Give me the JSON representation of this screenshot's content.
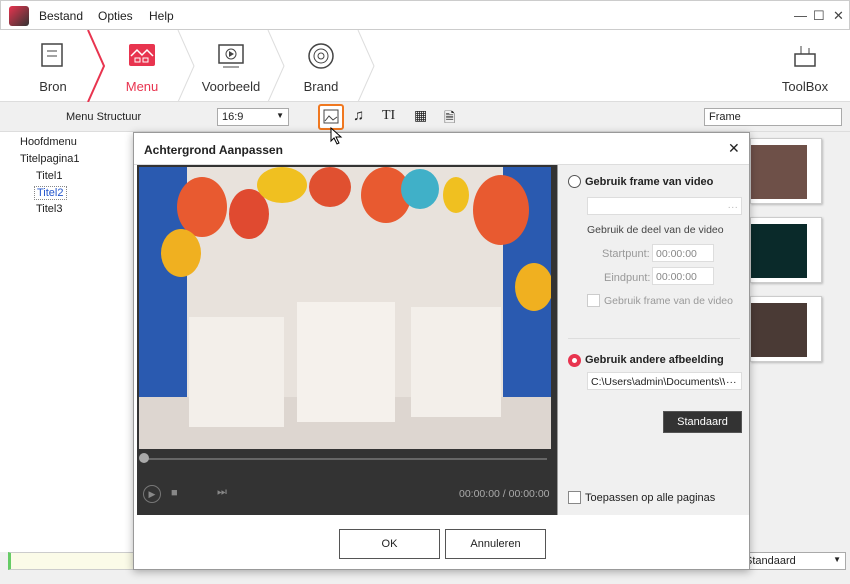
{
  "menu": {
    "items": [
      "Bestand",
      "Opties",
      "Help"
    ]
  },
  "window": {
    "minimize": "—",
    "maximize": "☐",
    "close": "✕"
  },
  "steps": [
    {
      "label": "Bron",
      "icon": "document-icon"
    },
    {
      "label": "Menu",
      "icon": "menu-image-icon",
      "active": true
    },
    {
      "label": "Voorbeeld",
      "icon": "play-screen-icon"
    },
    {
      "label": "Brand",
      "icon": "disc-icon"
    }
  ],
  "toolbox": {
    "label": "ToolBox"
  },
  "toolbar": {
    "menu_structure": "Menu Structuur",
    "aspect": "16:9",
    "frame": "Frame"
  },
  "tree": {
    "root": "Hoofdmenu",
    "page": "Titelpagina1",
    "items": [
      "Titel1",
      "Titel2",
      "Titel3"
    ],
    "selected": "Titel2"
  },
  "dialog": {
    "title": "Achtergrond Aanpassen",
    "time": "00:00:00 / 00:00:00",
    "use_video_frame": "Gebruik frame van video",
    "use_part": "Gebruik de deel van de video",
    "start_label": "Startpunt:",
    "start_value": "00:00:00",
    "end_label": "Eindpunt:",
    "end_value": "00:00:00",
    "use_frame_check": "Gebruik frame van de video",
    "use_other_image": "Gebruik andere afbeelding",
    "image_path": "C:\\Users\\admin\\Documents\\Wondershare",
    "dots": "···",
    "standard": "Standaard",
    "apply_all": "Toepassen op alle paginas",
    "ok": "OK",
    "cancel": "Annuleren"
  },
  "bottom": {
    "select": "Standaard"
  },
  "colors": {
    "accent": "#e8344f",
    "highlight": "#f07820",
    "thumbs": [
      "#6e5048",
      "#0a2a2a",
      "#4a3a35"
    ]
  }
}
